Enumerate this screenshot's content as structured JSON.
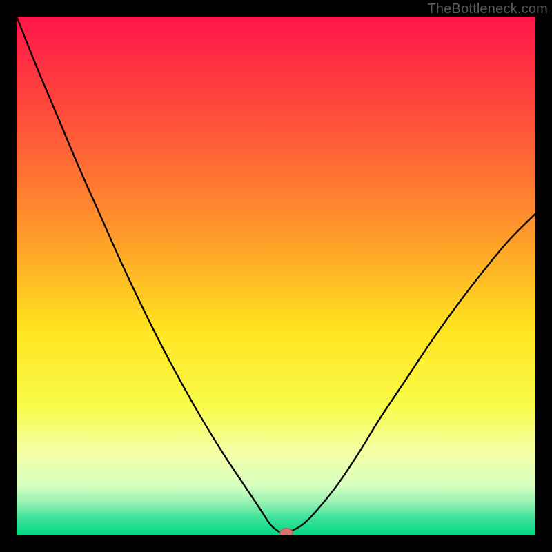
{
  "watermark": "TheBottleneck.com",
  "colors": {
    "frame": "#000000",
    "curve": "#000000",
    "marker_fill": "#d9726b",
    "marker_stroke": "#c55f58",
    "gradient_stops": [
      {
        "offset": 0.0,
        "color": "#ff1549"
      },
      {
        "offset": 0.22,
        "color": "#ff5638"
      },
      {
        "offset": 0.42,
        "color": "#ff9a2a"
      },
      {
        "offset": 0.6,
        "color": "#ffe31f"
      },
      {
        "offset": 0.75,
        "color": "#f8fb49"
      },
      {
        "offset": 0.84,
        "color": "#f4ffa6"
      },
      {
        "offset": 0.905,
        "color": "#d6ffc0"
      },
      {
        "offset": 0.94,
        "color": "#8ff0b0"
      },
      {
        "offset": 0.965,
        "color": "#40e39a"
      },
      {
        "offset": 1.0,
        "color": "#00d884"
      }
    ]
  },
  "chart_data": {
    "type": "line",
    "title": "",
    "xlabel": "",
    "ylabel": "",
    "xlim": [
      0,
      100
    ],
    "ylim": [
      0,
      100
    ],
    "grid": false,
    "series": [
      {
        "name": "bottleneck-curve",
        "x": [
          0,
          4,
          8,
          12,
          16,
          20,
          24,
          28,
          32,
          36,
          40,
          44,
          47,
          49,
          51,
          52,
          55,
          58,
          62,
          66,
          70,
          75,
          80,
          85,
          90,
          95,
          100
        ],
        "values": [
          100,
          90,
          80.5,
          71,
          62,
          53,
          44.5,
          36.5,
          29,
          22,
          15.5,
          9.5,
          5,
          2,
          0.5,
          0.5,
          2,
          5,
          10,
          16,
          22.5,
          30,
          37.5,
          44.5,
          51,
          57,
          62
        ]
      }
    ],
    "annotations": [
      {
        "type": "marker",
        "x": 52,
        "y": 0.5,
        "name": "optimal-point"
      }
    ]
  }
}
